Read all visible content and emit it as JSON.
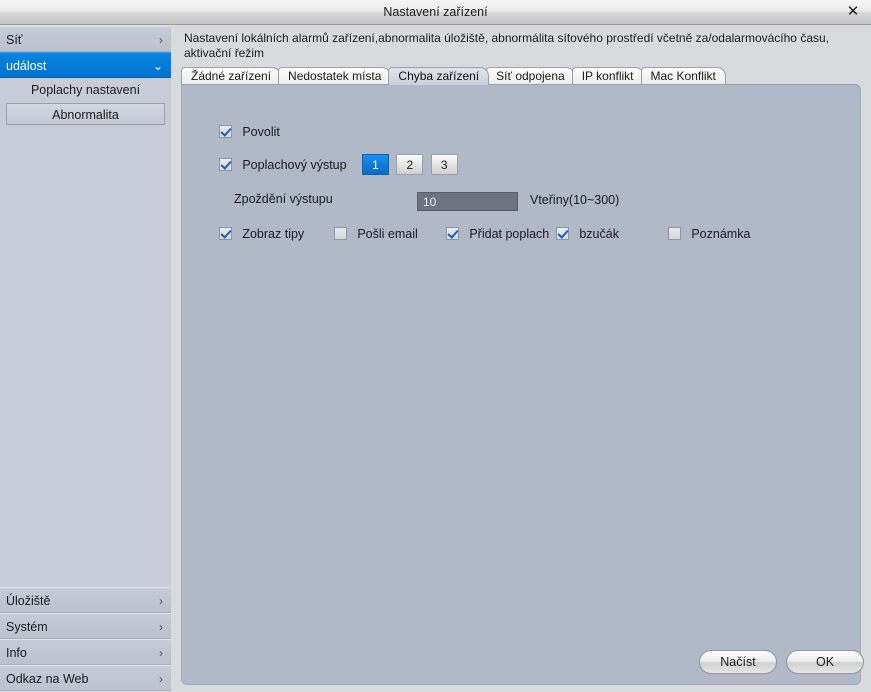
{
  "window": {
    "title": "Nastavení zařízení",
    "close_icon": "close-icon",
    "close_glyph": "✕"
  },
  "sidebar": {
    "items": [
      {
        "label": "Síť",
        "chevron": "›",
        "state": "collapsed"
      },
      {
        "label": "událost",
        "chevron": "⌄",
        "state": "expanded"
      }
    ],
    "sub_items": [
      {
        "label": "Poplachy nastavení",
        "selected": false
      },
      {
        "label": "Abnormalita",
        "selected": true
      }
    ],
    "bottom_items": [
      {
        "label": "Úložiště",
        "chevron": "›"
      },
      {
        "label": "Systém",
        "chevron": "›"
      },
      {
        "label": "Info",
        "chevron": "›"
      },
      {
        "label": "Odkaz na Web",
        "chevron": "›"
      }
    ]
  },
  "main": {
    "description": "Nastavení lokálních alarmů zařízení,abnormalita úložiště, abnormálita sítového prostředí včetně za/odalarmovácího času, aktivační řežim",
    "tabs": [
      {
        "label": "Žádné zařízení",
        "active": false
      },
      {
        "label": "Nedostatek místa",
        "active": false
      },
      {
        "label": "Chyba zařízení",
        "active": true
      },
      {
        "label": "Síť odpojena",
        "active": false
      },
      {
        "label": "IP konflikt",
        "active": false
      },
      {
        "label": "Mac Konflikt",
        "active": false
      }
    ],
    "form": {
      "enable": {
        "label": "Povolit",
        "checked": true
      },
      "alarm_output": {
        "label": "Poplachový výstup",
        "checked": true
      },
      "output_channels": [
        {
          "label": "1",
          "selected": true
        },
        {
          "label": "2",
          "selected": false
        },
        {
          "label": "3",
          "selected": false
        }
      ],
      "delay": {
        "label": "Zpoždění výstupu",
        "value": "10",
        "placeholder": "10",
        "unit": "Vteřiny(10~300)"
      },
      "options": [
        {
          "label": "Zobraz tipy",
          "checked": true
        },
        {
          "label": "Pošli email",
          "checked": false
        },
        {
          "label": "Přidat poplach",
          "checked": true
        },
        {
          "label": "bzučák",
          "checked": true
        },
        {
          "label": "Poznámka",
          "checked": false
        }
      ]
    },
    "buttons": {
      "load": "Načíst",
      "ok": "OK"
    }
  },
  "colors": {
    "accent": "#0a7ed4",
    "panel": "#b1b8c7",
    "sidebar": "#c8ccd6",
    "window_bg": "#d8dade",
    "input_bg": "#6c737f"
  }
}
